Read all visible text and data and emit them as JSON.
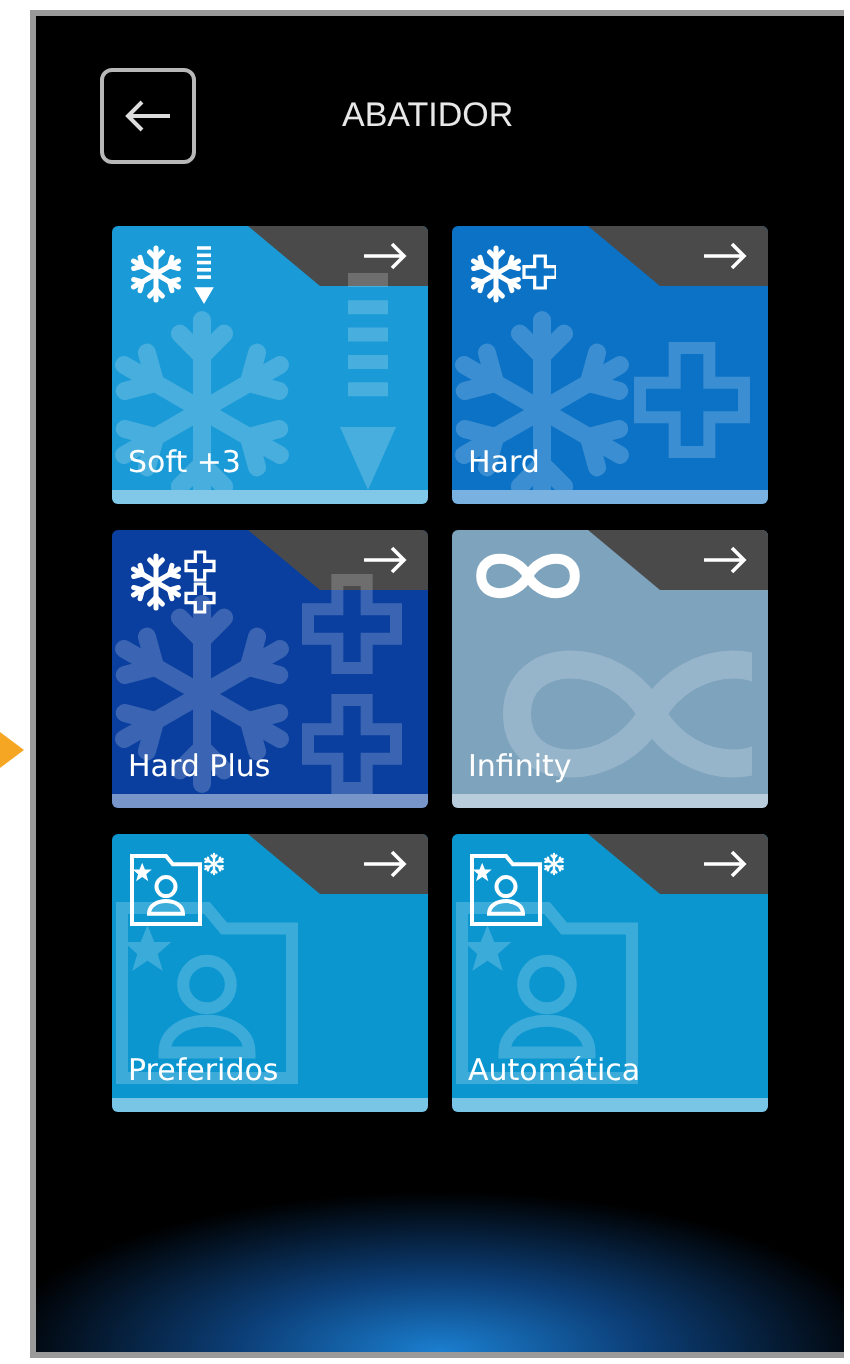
{
  "header": {
    "title": "ABATIDOR"
  },
  "tiles": [
    {
      "label": "Soft +3",
      "kind": "soft",
      "color": "#1a9ad6"
    },
    {
      "label": "Hard",
      "kind": "hard",
      "color": "#0b72c6"
    },
    {
      "label": "Hard Plus",
      "kind": "hardplus",
      "color": "#0a3f9f"
    },
    {
      "label": "Infinity",
      "kind": "infinity",
      "color": "#7ea3bd"
    },
    {
      "label": "Preferidos",
      "kind": "favorites",
      "color": "#0b96d0"
    },
    {
      "label": "Automática",
      "kind": "favorites",
      "color": "#0b96d0"
    }
  ]
}
